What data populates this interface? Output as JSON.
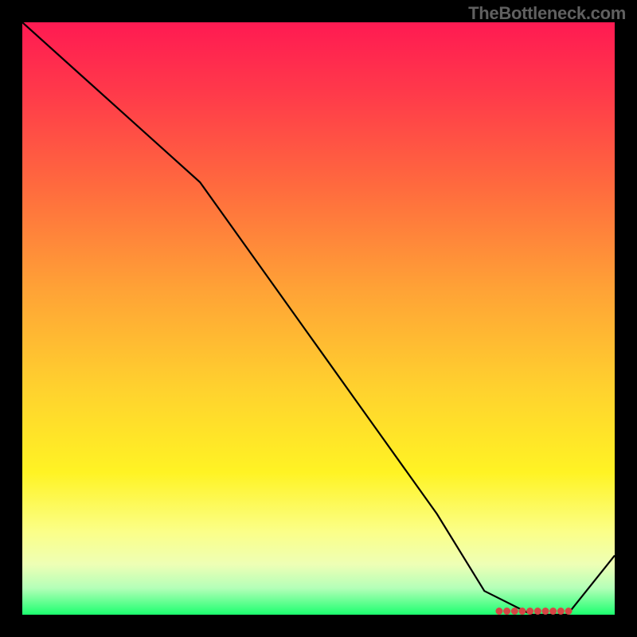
{
  "watermark": "TheBottleneck.com",
  "chart_data": {
    "type": "line",
    "title": "",
    "xlabel": "",
    "ylabel": "",
    "xlim": [
      0,
      100
    ],
    "ylim": [
      0,
      100
    ],
    "grid": false,
    "series": [
      {
        "name": "curve",
        "x": [
          0,
          10,
          20,
          30,
          40,
          50,
          60,
          70,
          78,
          86,
          92,
          100
        ],
        "values": [
          100,
          91,
          82,
          73,
          59,
          45,
          31,
          17,
          4,
          0,
          0,
          10
        ]
      }
    ],
    "markers": {
      "name": "bottom-cluster",
      "color": "#d64545",
      "x": [
        80.5,
        81.8,
        83.1,
        84.4,
        85.7,
        87.0,
        88.3,
        89.6,
        90.9,
        92.2
      ],
      "values": [
        0.6,
        0.6,
        0.6,
        0.6,
        0.6,
        0.6,
        0.6,
        0.6,
        0.6,
        0.6
      ]
    },
    "gradient_stops": [
      {
        "pos": 0,
        "color": "#ff1a52"
      },
      {
        "pos": 0.12,
        "color": "#ff3a4a"
      },
      {
        "pos": 0.28,
        "color": "#ff6b3e"
      },
      {
        "pos": 0.45,
        "color": "#ffa236"
      },
      {
        "pos": 0.62,
        "color": "#ffd22e"
      },
      {
        "pos": 0.76,
        "color": "#fff324"
      },
      {
        "pos": 0.86,
        "color": "#fbff88"
      },
      {
        "pos": 0.915,
        "color": "#eeffb5"
      },
      {
        "pos": 0.955,
        "color": "#b4ffb8"
      },
      {
        "pos": 1.0,
        "color": "#1cff6f"
      }
    ]
  }
}
